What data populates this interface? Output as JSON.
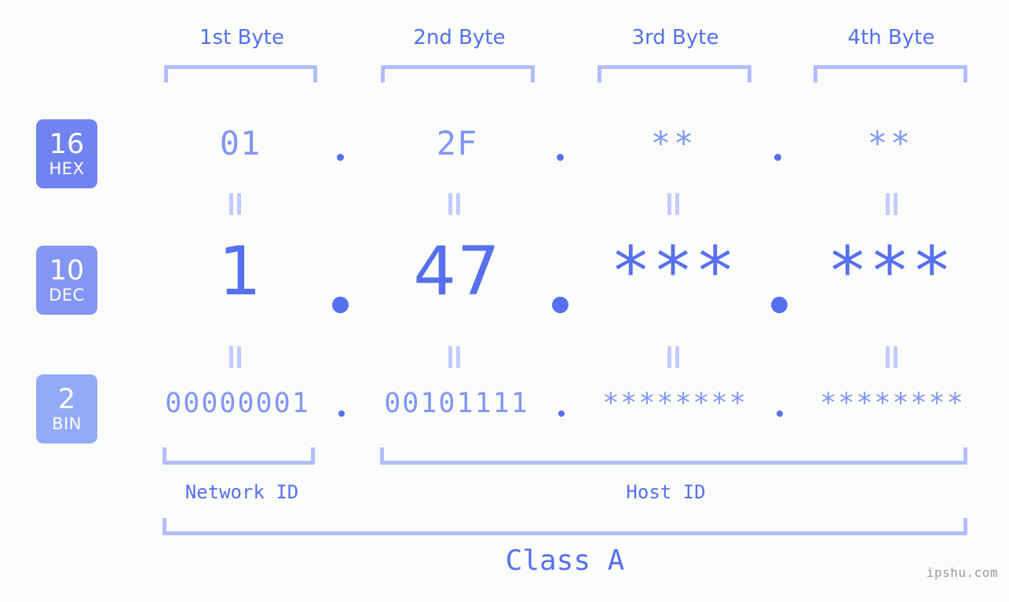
{
  "meta": {
    "watermark": "ipshu.com",
    "background_color": "#fbfdfa",
    "accent_color": "#5670ef",
    "accent_light_color": "#8296f4",
    "bracket_color": "#b3bdfb"
  },
  "byte_headers": [
    {
      "label": "1st Byte"
    },
    {
      "label": "2nd Byte"
    },
    {
      "label": "3rd Byte"
    },
    {
      "label": "4th Byte"
    }
  ],
  "bases": [
    {
      "num": "16",
      "cap": "HEX",
      "color": "#7183f1"
    },
    {
      "num": "10",
      "cap": "DEC",
      "color": "#8496f4"
    },
    {
      "num": "2",
      "cap": "BIN",
      "color": "#93aaf8"
    }
  ],
  "rows": {
    "hex": {
      "base_num": "16",
      "base_cap": "HEX",
      "values": [
        "01",
        "2F",
        "**",
        "**"
      ],
      "separator": "."
    },
    "dec": {
      "base_num": "10",
      "base_cap": "DEC",
      "values": [
        "1",
        "47",
        "***",
        "***"
      ],
      "separator": "."
    },
    "bin": {
      "base_num": "2",
      "base_cap": "BIN",
      "values": [
        "00000001",
        "00101111",
        "********",
        "********"
      ],
      "separator": "."
    }
  },
  "equals_symbol": "=",
  "sections": [
    {
      "label": "Network ID"
    },
    {
      "label": "Host ID"
    }
  ],
  "class": {
    "label": "Class A"
  }
}
